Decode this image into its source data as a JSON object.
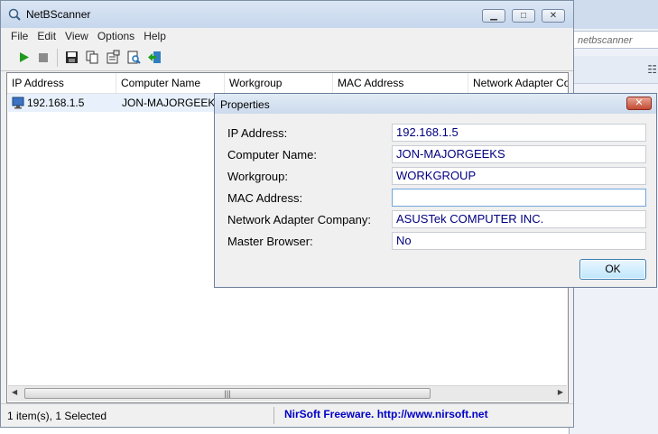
{
  "background_window": {
    "search_text": "netbscanner"
  },
  "window": {
    "title": "NetBScanner",
    "menu": [
      "File",
      "Edit",
      "View",
      "Options",
      "Help"
    ],
    "columns": [
      "IP Address",
      "Computer Name",
      "Workgroup",
      "MAC Address",
      "Network Adapter Co"
    ],
    "rows": [
      {
        "ip": "192.168.1.5",
        "computer_name": "JON-MAJORGEEKS"
      }
    ],
    "status_left": "1 item(s), 1 Selected",
    "status_right": "NirSoft Freeware.  http://www.nirsoft.net"
  },
  "dialog": {
    "title": "Properties",
    "close_glyph": "✕",
    "fields": [
      {
        "label": "IP Address:",
        "value": "192.168.1.5"
      },
      {
        "label": "Computer Name:",
        "value": "JON-MAJORGEEKS"
      },
      {
        "label": "Workgroup:",
        "value": "WORKGROUP"
      },
      {
        "label": "MAC Address:",
        "value": ""
      },
      {
        "label": "Network Adapter Company:",
        "value": "ASUSTek COMPUTER INC."
      },
      {
        "label": "Master Browser:",
        "value": "No"
      }
    ],
    "ok_label": "OK"
  },
  "colors": {
    "link": "#0000c8",
    "value_text": "#000080"
  }
}
